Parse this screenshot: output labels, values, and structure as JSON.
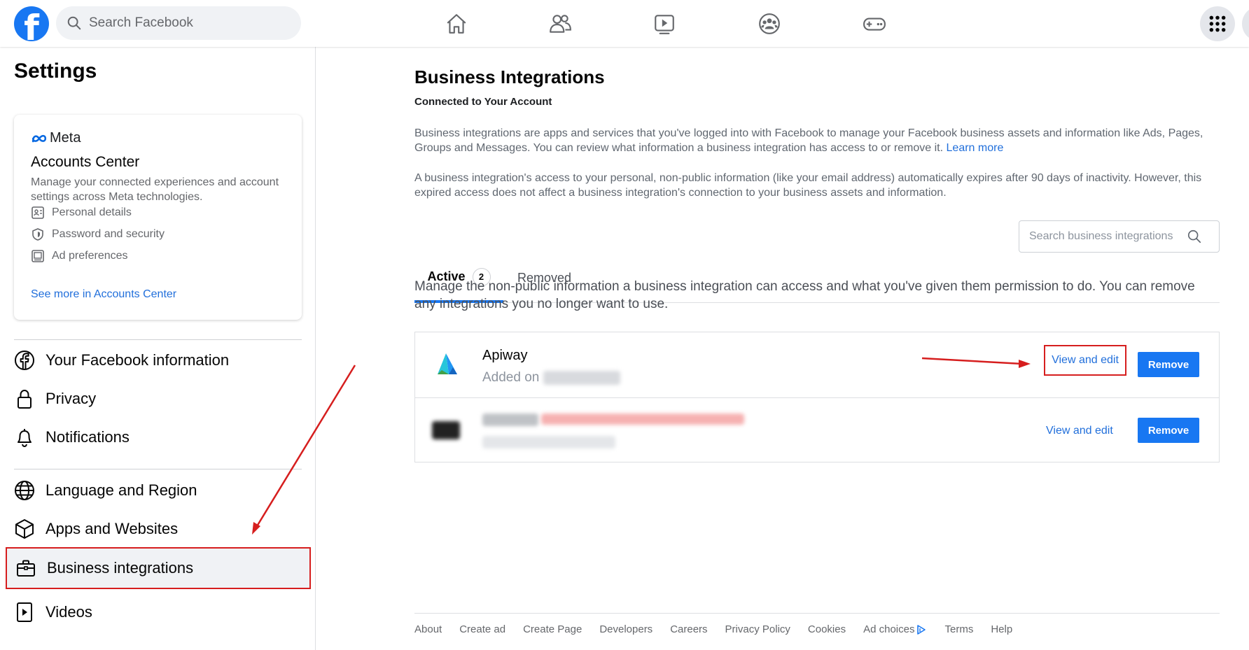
{
  "topbar": {
    "logo_letter": "f",
    "search_placeholder": "Search Facebook",
    "nav_icons": [
      "home-icon",
      "friends-icon",
      "watch-icon",
      "groups-icon",
      "gaming-icon"
    ],
    "menu_icon": "apps-grid-icon"
  },
  "sidebar": {
    "title": "Settings",
    "accounts_center": {
      "brand": "Meta",
      "title": "Accounts Center",
      "description": "Manage your connected experiences and account settings across Meta technologies.",
      "items": [
        {
          "label": "Personal details",
          "icon": "id-card-icon"
        },
        {
          "label": "Password and security",
          "icon": "shield-icon"
        },
        {
          "label": "Ad preferences",
          "icon": "monitor-icon"
        }
      ],
      "link": "See more in Accounts Center"
    },
    "nav": [
      {
        "label": "Your Facebook information",
        "icon": "facebook-icon"
      },
      {
        "label": "Privacy",
        "icon": "lock-icon"
      },
      {
        "label": "Notifications",
        "icon": "bell-icon"
      },
      {
        "label": "Language and Region",
        "icon": "globe-icon"
      },
      {
        "label": "Apps and Websites",
        "icon": "cube-icon"
      },
      {
        "label": "Business integrations",
        "icon": "briefcase-icon",
        "active": true
      },
      {
        "label": "Videos",
        "icon": "video-icon"
      }
    ]
  },
  "main": {
    "title": "Business Integrations",
    "subtitle": "Connected to Your Account",
    "paragraph1": "Business integrations are apps and services that you've logged into with Facebook to manage your Facebook business assets and information like Ads, Pages, Groups and Messages. You can review what information a business integration has access to or remove it.",
    "learn_more": "Learn more",
    "paragraph2": "A business integration's access to your personal, non-public information (like your email address) automatically expires after 90 days of inactivity. However, this expired access does not affect a business integration's connection to your business assets and information.",
    "tabs": {
      "active_label": "Active",
      "active_count": "2",
      "removed_label": "Removed",
      "search_placeholder": "Search business integrations"
    },
    "manage_text": "Manage the non-public information a business integration can access and what you've given them permission to do. You can remove any integrations you no longer want to use.",
    "integrations": [
      {
        "name": "Apiway",
        "added_prefix": "Added on",
        "view_edit": "View and edit",
        "remove": "Remove"
      },
      {
        "view_edit": "View and edit",
        "remove": "Remove"
      }
    ]
  },
  "footer": {
    "links": [
      "About",
      "Create ad",
      "Create Page",
      "Developers",
      "Careers",
      "Privacy Policy",
      "Cookies",
      "Ad choices",
      "Terms",
      "Help"
    ]
  },
  "colors": {
    "brand_blue": "#1877f2",
    "link_blue": "#216fdb",
    "annotation_red": "#d61e1e"
  }
}
